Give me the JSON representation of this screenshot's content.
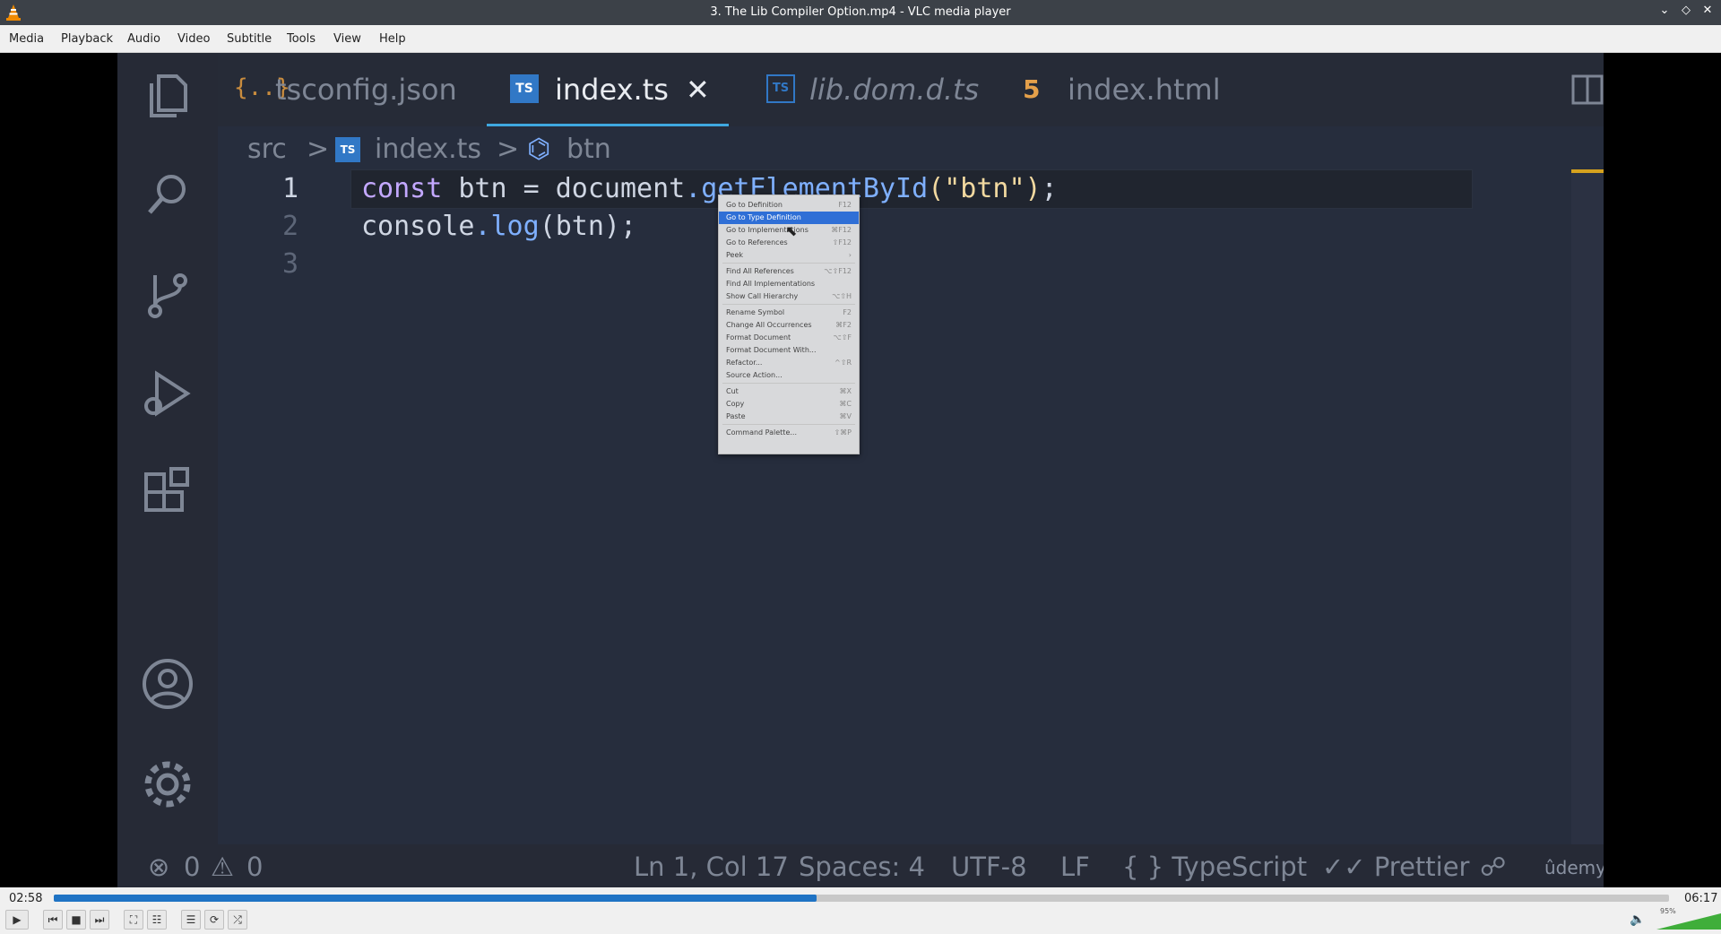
{
  "window": {
    "title": "3. The Lib Compiler Option.mp4 - VLC media player",
    "controls": {
      "minimize": "⌄",
      "restore": "◇",
      "close": "✕"
    }
  },
  "menu": [
    "Media",
    "Playback",
    "Audio",
    "Video",
    "Subtitle",
    "Tools",
    "View",
    "Help"
  ],
  "video": {
    "tabs": [
      {
        "label": "tsconfig.json",
        "icon": "json-icon"
      },
      {
        "label": "index.ts",
        "icon": "ts-icon",
        "close": "✕"
      },
      {
        "label": "lib.dom.d.ts",
        "icon": "ts-icon"
      },
      {
        "label": "index.html",
        "icon": "html5-icon"
      }
    ],
    "breadcrumb": {
      "folder": "src",
      "file": "index.ts",
      "symbol": "btn",
      "sep": ">"
    },
    "lines": [
      {
        "num": "1",
        "kw": "const",
        "rest1": " btn = document",
        "fn": ".getElementById",
        "str": "(\"btn\")",
        "rest2": ";"
      },
      {
        "num": "2",
        "pre": "console",
        "fn": ".log",
        "rest": "(btn);"
      },
      {
        "num": "3"
      }
    ],
    "context_menu": [
      {
        "label": "Go to Definition",
        "key": "F12"
      },
      {
        "label": "Go to Type Definition",
        "key": "",
        "selected": true
      },
      {
        "label": "Go to Implementations",
        "key": "⌘F12"
      },
      {
        "label": "Go to References",
        "key": "⇧F12"
      },
      {
        "label": "Peek",
        "key": "›"
      },
      {
        "label": "Find All References",
        "key": "⌥⇧F12"
      },
      {
        "label": "Find All Implementations",
        "key": ""
      },
      {
        "label": "Show Call Hierarchy",
        "key": "⌥⇧H"
      },
      {
        "label": "Rename Symbol",
        "key": "F2"
      },
      {
        "label": "Change All Occurrences",
        "key": "⌘F2"
      },
      {
        "label": "Format Document",
        "key": "⌥⇧F"
      },
      {
        "label": "Format Document With...",
        "key": ""
      },
      {
        "label": "Refactor...",
        "key": "^⇧R"
      },
      {
        "label": "Source Action...",
        "key": ""
      },
      {
        "label": "Cut",
        "key": "⌘X"
      },
      {
        "label": "Copy",
        "key": "⌘C"
      },
      {
        "label": "Paste",
        "key": "⌘V"
      },
      {
        "label": "Command Palette...",
        "key": "⇧⌘P"
      }
    ],
    "status": {
      "errors": "0",
      "warnings": "0",
      "position": "Ln 1, Col 17",
      "spaces": "Spaces: 4",
      "encoding": "UTF-8",
      "eol": "LF",
      "language": "{ } TypeScript",
      "formatter": "✓✓ Prettier",
      "watermark": "ûdemy"
    }
  },
  "playback": {
    "elapsed": "02:58",
    "total": "06:17",
    "progress": 0.472,
    "volume_label": "95%",
    "volume": 0.95
  },
  "colors": {
    "accent": "#1f73c4",
    "selection": "#2f6fd6"
  }
}
